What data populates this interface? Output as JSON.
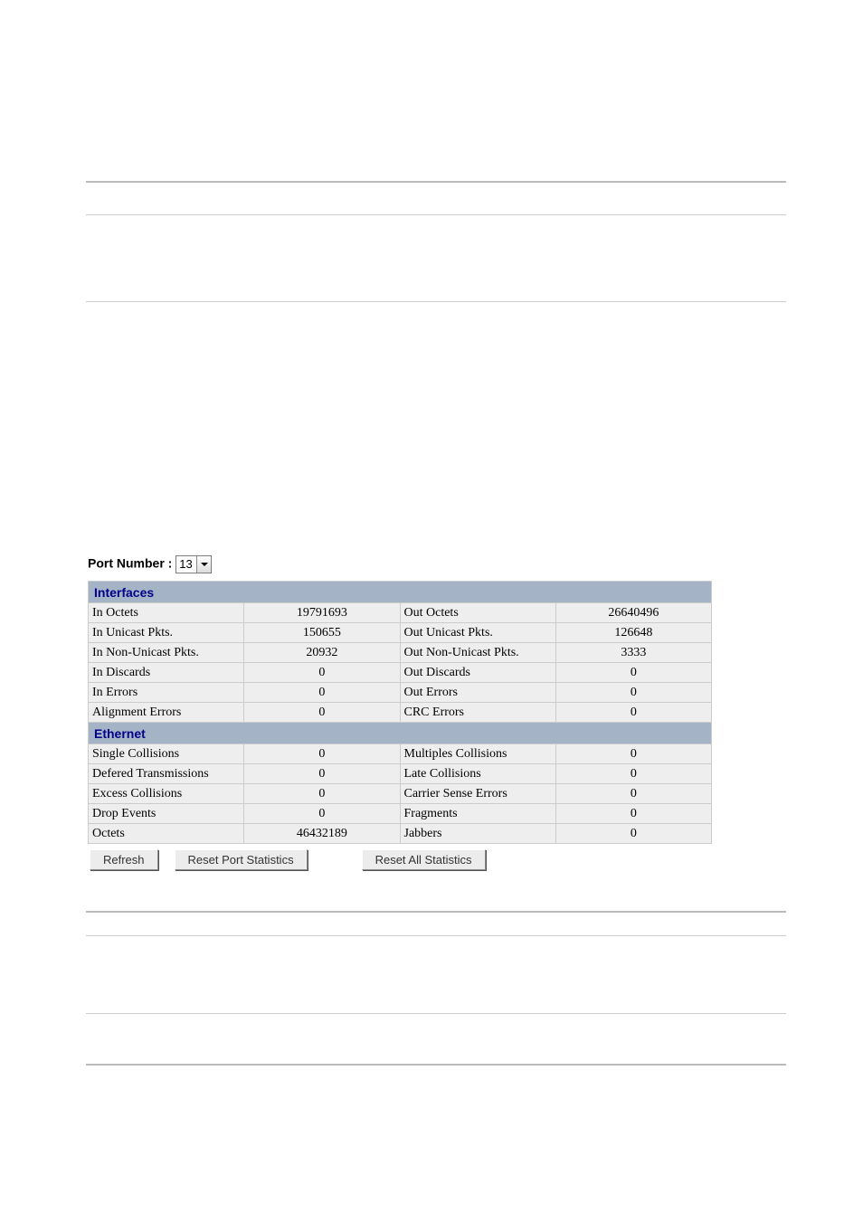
{
  "port_selector": {
    "label": "Port Number :",
    "value": "13"
  },
  "sections": {
    "interfaces": {
      "title": "Interfaces",
      "rows": [
        {
          "l1": "In Octets",
          "v1": "19791693",
          "l2": "Out Octets",
          "v2": "26640496"
        },
        {
          "l1": "In Unicast Pkts.",
          "v1": "150655",
          "l2": "Out Unicast Pkts.",
          "v2": "126648"
        },
        {
          "l1": "In Non-Unicast Pkts.",
          "v1": "20932",
          "l2": "Out Non-Unicast Pkts.",
          "v2": "3333"
        },
        {
          "l1": "In Discards",
          "v1": "0",
          "l2": "Out Discards",
          "v2": "0"
        },
        {
          "l1": "In Errors",
          "v1": "0",
          "l2": "Out Errors",
          "v2": "0"
        },
        {
          "l1": "Alignment Errors",
          "v1": "0",
          "l2": "CRC Errors",
          "v2": "0"
        }
      ]
    },
    "ethernet": {
      "title": "Ethernet",
      "rows": [
        {
          "l1": "Single Collisions",
          "v1": "0",
          "l2": "Multiples Collisions",
          "v2": "0"
        },
        {
          "l1": "Defered Transmissions",
          "v1": "0",
          "l2": "Late Collisions",
          "v2": "0"
        },
        {
          "l1": "Excess Collisions",
          "v1": "0",
          "l2": "Carrier Sense Errors",
          "v2": "0"
        },
        {
          "l1": "Drop Events",
          "v1": "0",
          "l2": "Fragments",
          "v2": "0"
        },
        {
          "l1": "Octets",
          "v1": "46432189",
          "l2": "Jabbers",
          "v2": "0"
        }
      ]
    }
  },
  "buttons": {
    "refresh": "Refresh",
    "reset_port": "Reset Port Statistics",
    "reset_all": "Reset All Statistics"
  }
}
